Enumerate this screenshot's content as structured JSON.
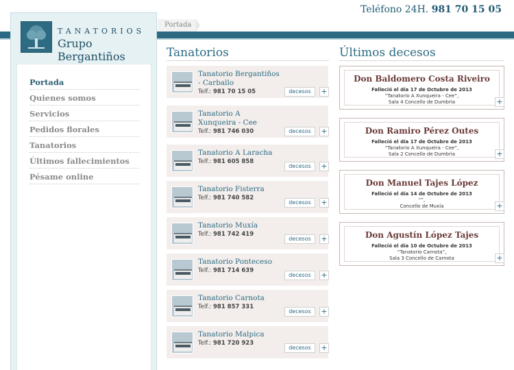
{
  "header": {
    "phone_label": "Teléfono 24H.",
    "phone_number": "981 70 15 05"
  },
  "logo": {
    "line1": "TANATORIOS",
    "line2": "Grupo Bergantiños"
  },
  "breadcrumb": {
    "current": "Portada"
  },
  "menu": [
    {
      "label": "Portada",
      "active": true
    },
    {
      "label": "Quienes somos"
    },
    {
      "label": "Servicios"
    },
    {
      "label": "Pedidos florales"
    },
    {
      "label": "Tanatorios"
    },
    {
      "label": "Últimos fallecimientos"
    },
    {
      "label": "Pésame online"
    }
  ],
  "tanatorios": {
    "title": "Tanatorios",
    "decesos_label": "decesos",
    "plus_label": "+",
    "tel_prefix": "Telf.:",
    "items": [
      {
        "name": "Tanatorio Bergantiños - Carballo",
        "tel": "981 70 15 05"
      },
      {
        "name": "Tanatorio A Xunqueira - Cee",
        "tel": "981 746 030"
      },
      {
        "name": "Tanatorio A Laracha",
        "tel": "981 605 858"
      },
      {
        "name": "Tanatorio Fisterra",
        "tel": "981 740 582"
      },
      {
        "name": "Tanatorio Muxía",
        "tel": "981 742 419"
      },
      {
        "name": "Tanatorio Ponteceso",
        "tel": "981 714 639"
      },
      {
        "name": "Tanatorio Carnota",
        "tel": "981 857 331"
      },
      {
        "name": "Tanatorio Malpica",
        "tel": "981 720 923"
      }
    ]
  },
  "decesos": {
    "title": "Últimos decesos",
    "plus_label": "+",
    "items": [
      {
        "name": "Don Baldomero Costa Riveiro",
        "line1": "Falleció el día 17 de Octubre de 2013",
        "line2": "“Tanatorio A Xunqueira - Cee”,",
        "line3": "Sala 4 Concello de Dumbria"
      },
      {
        "name": "Don Ramiro Pérez Outes",
        "line1": "Falleció el día 17 de Octubre de 2013",
        "line2": "“Tanatorio A Xunqueira - Cee”,",
        "line3": "Sala 2 Concello de Dumbria"
      },
      {
        "name": "Don Manuel Tajes López",
        "line1": "Falleció el día 14 de Octubre de 2013",
        "line2": "“”,",
        "line3": "Concello de Muxía"
      },
      {
        "name": "Don Agustín López Tajes",
        "line1": "Falleció el día 10 de Octubre de 2013",
        "line2": "“Tanatorio Carnota”,",
        "line3": "Sala 3 Concello de Carnota"
      }
    ]
  }
}
